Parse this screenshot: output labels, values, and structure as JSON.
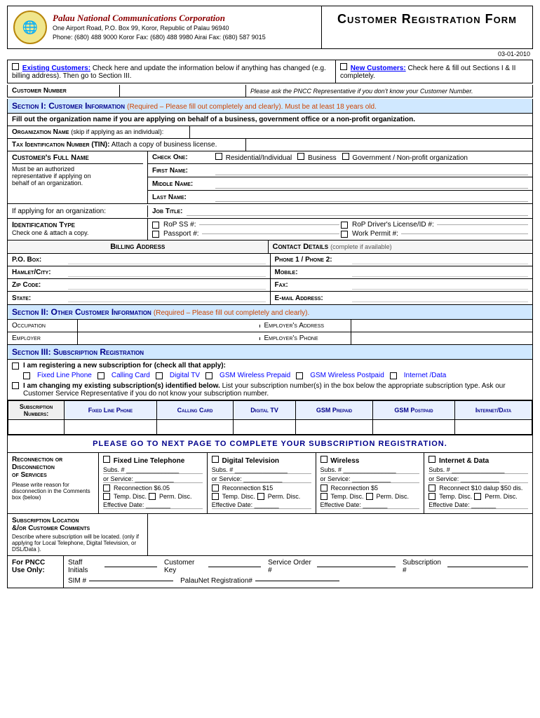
{
  "header": {
    "company_name": "Palau National Communications Corporation",
    "address_line1": "One Airport Road, P.O. Box 99, Koror, Republic of Palau 96940",
    "phone_line": "Phone: (680) 488 9000   Koror Fax: (680) 488 9980   Airai Fax: (680) 587 9015",
    "form_title": "Customer Registration Form",
    "date": "03-01-2010"
  },
  "customer_type": {
    "existing_label": "Existing Customers:",
    "existing_note": " Check here and update the information below if anything has changed  (e.g. billing address).  Then go to Section III.",
    "new_label": "New Customers:",
    "new_note": " Check here & fill out Sections I & II completely."
  },
  "customer_number": {
    "label": "Customer Number",
    "note": "Please ask the PNCC Representative if you don't know your Customer Number."
  },
  "section1": {
    "header": "Section I:  Customer Information",
    "note": " (Required – Please fill out completely and clearly).  Must  be at least 18 years old.",
    "fill_note": "Fill out the organization name if you are applying on behalf of a business, government office or a non-profit organization.",
    "org_name_label": "Organization Name",
    "org_name_note": "(skip if applying as an individual):",
    "tin_label": "Tax Identification Number (TIN):",
    "tin_note": " Attach a copy of business license.",
    "full_name_label": "Customer's Full Name",
    "full_name_note1": "Must be an authorized",
    "full_name_note2": "representative if applying on",
    "full_name_note3": "behalf of an organization.",
    "check_one_label": "Check One:",
    "check_options": [
      "Residential/Individual",
      "Business",
      "Government / Non-profit organization"
    ],
    "first_name_label": "First Name:",
    "middle_name_label": "Middle Name:",
    "last_name_label": "Last Name:",
    "job_title_label": "Job Title:",
    "if_applying": "If applying for an organization:",
    "id_type_label": "Identification Type",
    "id_type_note": "Check one & attach a copy.",
    "id_options": [
      "RoP SS #: ___________________________",
      "RoP Driver's License/ID #: ___________________________",
      "Passport #: ___________________________",
      "Work Permit #: ___________________________"
    ]
  },
  "billing": {
    "header": "Billing Address",
    "contact_header": "Contact Details",
    "contact_note": "(complete if available)",
    "po_box": "P.O. Box:",
    "hamlet": "Hamlet/City:",
    "zip": "Zip Code:",
    "state": "State:",
    "phone12": "Phone 1 / Phone 2:",
    "mobile": "Mobile:",
    "fax": "Fax:",
    "email": "E-mail Address:"
  },
  "section2": {
    "header": "Section II:  Other Customer Information",
    "note": " (Required – Please fill out completely and clearly).",
    "occupation_label": "Occupation",
    "employer_label": "Employer",
    "employer_address_label": "Employer's Address",
    "employer_phone_label": "Employer's Phone"
  },
  "section3": {
    "header": "Section III:  Subscription Registration",
    "register_label": "I am registering a new subscription for (check all that apply):",
    "services": [
      "Fixed Line Phone",
      "Calling Card",
      "Digital TV",
      "GSM Wireless Prepaid",
      "GSM Wireless Postpaid",
      "Internet /Data"
    ],
    "changing_label": "I am changing my existing subscription(s) identified below.",
    "changing_note": " List your subscription number(s) in the box below the appropriate subscription type.  Ask our Customer Service Representative if you do not know your subscription number.",
    "sub_headers": [
      "Subscription Numbers:",
      "Fixed Line Phone",
      "Calling Card",
      "Digital TV",
      "GSM Prepaid",
      "GSM Postpaid",
      "Internet/Data"
    ],
    "next_page": "Please go to next page to complete your subscription registration."
  },
  "reconnection": {
    "label1": "Reconnection or",
    "label2": "Disconnection",
    "label3": "of Services",
    "note": "Please write reason for disconnection in the Comments box (below)",
    "columns": [
      {
        "title": "Fixed Line Telephone",
        "subs": "Subs. # ___________________",
        "service": "or Service: ___________________",
        "recon": "Reconnection $6.05",
        "temp": "Temp. Disc.",
        "perm": "Perm. Disc.",
        "eff": "Effective Date: ___________"
      },
      {
        "title": "Digital Television",
        "subs": "Subs. # ___________________",
        "service": "or Service: ___________________",
        "recon": "Reconnection $15",
        "temp": "Temp. Disc.",
        "perm": "Perm. Disc.",
        "eff": "Effective Date: ___________"
      },
      {
        "title": "Wireless",
        "subs": "Subs. # ___________________",
        "service": "or Service: ___________________",
        "recon": "Reconnection $5",
        "temp": "Temp. Disc.",
        "perm": "Perm. Disc.",
        "eff": "Effective Date: ___________"
      },
      {
        "title": "Internet & Data",
        "subs": "Subs. # ___________________",
        "service": "or Service: ___________________",
        "recon": "Reconnect $10 dalup $50 dis.",
        "temp": "Temp. Disc.",
        "perm": "Perm. Disc.",
        "eff": "Effective Date: ___________"
      }
    ]
  },
  "sublocation": {
    "title": "Subscription Location",
    "title2": "&/or Customer Comments",
    "note": "Describe where subscription will be located. (only if applying for Local Telephone, Digital Television, or DSL/Data )."
  },
  "pncc": {
    "label": "For PNCC Use Only:",
    "staff_initials": "Staff Initials _________",
    "customer_key": "Customer Key __________",
    "service_order": "Service Order # __________________",
    "subscription": "Subscription # _______________",
    "sim": "SIM # ___________________",
    "palaunet": "PalauNet Registration# ___________________"
  }
}
